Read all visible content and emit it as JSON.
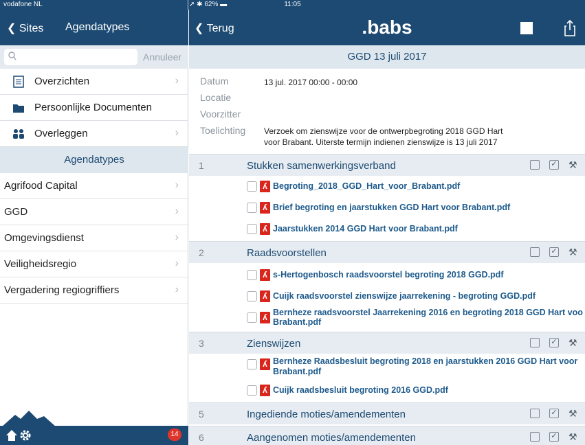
{
  "status_bar": {
    "carrier": "vodafone NL",
    "time": "11:05",
    "battery": "62%"
  },
  "left_pane": {
    "back_label": "Sites",
    "title": "Agendatypes",
    "search": {
      "placeholder": "",
      "cancel_label": "Annuleer"
    },
    "menu_items": [
      {
        "label": "Overzichten",
        "icon": "document-list-icon"
      },
      {
        "label": "Persoonlijke Documenten",
        "icon": "folder-icon"
      },
      {
        "label": "Overleggen",
        "icon": "people-icon"
      }
    ],
    "section_header": "Agendatypes",
    "agenda_types": [
      "Agrifood Capital",
      "GGD",
      "Omgevingsdienst",
      "Veiligheidsregio",
      "Vergadering regiogriffiers"
    ],
    "footer": {
      "notification_count": "14"
    }
  },
  "right_pane": {
    "back_label": "Terug",
    "logo": ".babs",
    "meeting_title": "GGD 13 juli 2017",
    "meta": {
      "date_label": "Datum",
      "date_value": "13 jul. 2017 00:00 - 00:00",
      "location_label": "Locatie",
      "chair_label": "Voorzitter",
      "explanation_label": "Toelichting",
      "explanation_value_line1": "Verzoek om zienswijze voor de ontwerpbegroting 2018 GGD Hart",
      "explanation_value_line2": "voor Brabant. Uiterste termijn indienen zienswijze is 13 juli 2017"
    },
    "agenda_items": [
      {
        "number": "1",
        "title": "Stukken samenwerkingsverband",
        "documents": [
          "Begroting_2018_GGD_Hart_voor_Brabant.pdf",
          "Brief begroting en jaarstukken GGD Hart voor Brabant.pdf",
          "Jaarstukken 2014 GGD Hart voor Brabant.pdf"
        ]
      },
      {
        "number": "2",
        "title": "Raadsvoorstellen",
        "documents": [
          "s-Hertogenbosch raadsvoorstel begroting 2018 GGD.pdf",
          "Cuijk raadsvoorstel zienswijze jaarrekening - begroting GGD.pdf",
          "Bernheze raadsvoorstel Jaarrekening 2016 en begroting 2018 GGD Hart voo",
          "Brabant.pdf"
        ]
      },
      {
        "number": "3",
        "title": "Zienswijzen",
        "documents": [
          "Bernheze Raadsbesluit begroting 2018 en jaarstukken 2016 GGD Hart voor",
          "Brabant.pdf",
          "Cuijk raadsbesluit begroting 2016 GGD.pdf"
        ]
      },
      {
        "number": "5",
        "title": "Ingediende moties/amendementen",
        "documents": []
      },
      {
        "number": "6",
        "title": "Aangenomen moties/amendementen",
        "documents": []
      }
    ]
  },
  "colors": {
    "nav_blue": "#1d4a72",
    "section_bg": "#dfe7ee",
    "pdf_red": "#d9251c",
    "link_blue": "#1d5a8c"
  }
}
